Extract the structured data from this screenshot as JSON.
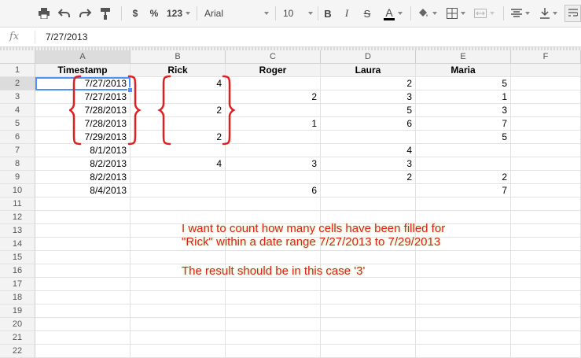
{
  "toolbar": {
    "print_icon": "print-icon",
    "undo_icon": "undo-icon",
    "redo_icon": "redo-icon",
    "paint_format_icon": "paint-format-icon",
    "currency_label": "$",
    "percent_label": "%",
    "number_format_label": "123",
    "font_name": "Arial",
    "font_size": "10",
    "bold_label": "B",
    "italic_label": "I",
    "strikethrough_label": "S",
    "text_color_label": "A",
    "text_color": "#000000"
  },
  "formula_bar": {
    "fx_label": "fx",
    "value": "7/27/2013"
  },
  "grid": {
    "columns": [
      "A",
      "B",
      "C",
      "D",
      "E",
      "F"
    ],
    "row_numbers": [
      "1",
      "2",
      "3",
      "4",
      "5",
      "6",
      "7",
      "8",
      "9",
      "10",
      "11",
      "12",
      "13",
      "14",
      "15",
      "16",
      "17",
      "18",
      "19",
      "20",
      "21",
      "22"
    ],
    "header_row": [
      "Timestamp",
      "Rick",
      "Roger",
      "Laura",
      "Maria",
      ""
    ],
    "rows": [
      [
        "7/27/2013",
        "4",
        "",
        "2",
        "5",
        ""
      ],
      [
        "7/27/2013",
        "",
        "2",
        "3",
        "1",
        ""
      ],
      [
        "7/28/2013",
        "2",
        "",
        "5",
        "3",
        ""
      ],
      [
        "7/28/2013",
        "",
        "1",
        "6",
        "7",
        ""
      ],
      [
        "7/29/2013",
        "2",
        "",
        "",
        "5",
        ""
      ],
      [
        "8/1/2013",
        "",
        "",
        "4",
        "",
        ""
      ],
      [
        "8/2/2013",
        "4",
        "3",
        "3",
        "",
        ""
      ],
      [
        "8/2/2013",
        "",
        "",
        "2",
        "2",
        ""
      ],
      [
        "8/4/2013",
        "",
        "6",
        "",
        "7",
        ""
      ]
    ],
    "active_cell": "A2",
    "bracket_color": "#e02020"
  },
  "annotation": {
    "line1": "I want to count how many cells have been filled for",
    "line2": "\"Rick\" within a date range 7/27/2013 to 7/29/2013",
    "line3": "The result should be in this case '3'"
  }
}
